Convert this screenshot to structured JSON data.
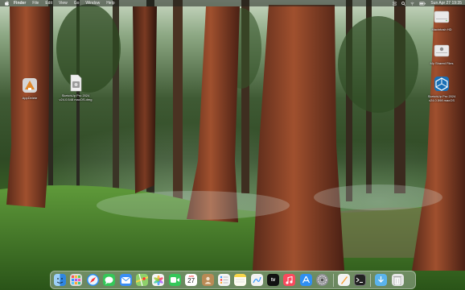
{
  "menubar": {
    "app_name": "Finder",
    "items": [
      "File",
      "Edit",
      "View",
      "Go",
      "Window",
      "Help"
    ],
    "clock": "Sun Apr 27 19:35",
    "status_icons": [
      "control-center-icon",
      "spotlight-icon",
      "wifi-icon",
      "battery-icon"
    ]
  },
  "desktop": {
    "icons": [
      {
        "label": "AppDelete",
        "icon": "app-delete-icon"
      },
      {
        "label": "SketchUp Pro 2024",
        "label2": "v24.0.548 macOS.dmg",
        "icon": "disk-image-icon"
      },
      {
        "label": "Macintosh HD",
        "icon": "hard-drive-icon"
      },
      {
        "label": "My Shared Files",
        "icon": "shared-drive-icon"
      },
      {
        "label": "SketchUp Pro 2024",
        "label2": "v24.0.598 macOS",
        "icon": "sketchup-icon"
      }
    ]
  },
  "dock": {
    "apps": [
      {
        "name": "Finder",
        "icon": "finder-icon",
        "color": "#4aa3f0"
      },
      {
        "name": "Launchpad",
        "icon": "launchpad-icon",
        "color": "#d9d9d9"
      },
      {
        "name": "Safari",
        "icon": "safari-icon",
        "color": "#2f8ff2"
      },
      {
        "name": "Messages",
        "icon": "messages-icon",
        "color": "#35c759"
      },
      {
        "name": "Mail",
        "icon": "mail-icon",
        "color": "#3a8ef5"
      },
      {
        "name": "Maps",
        "icon": "maps-icon",
        "color": "#6cc46a"
      },
      {
        "name": "Photos",
        "icon": "photos-icon",
        "color": "#f5f5f5"
      },
      {
        "name": "FaceTime",
        "icon": "facetime-icon",
        "color": "#34c759"
      },
      {
        "name": "Calendar",
        "icon": "calendar-icon",
        "color": "#ffffff",
        "text": "27",
        "subtext": "APR"
      },
      {
        "name": "Contacts",
        "icon": "contacts-icon",
        "color": "#b98a55"
      },
      {
        "name": "Reminders",
        "icon": "reminders-icon",
        "color": "#f4f4f4"
      },
      {
        "name": "Notes",
        "icon": "notes-icon",
        "color": "#f7d64a"
      },
      {
        "name": "Freeform",
        "icon": "freeform-icon",
        "color": "#f2f2f2"
      },
      {
        "name": "Apple TV",
        "icon": "tv-icon",
        "color": "#111111",
        "text": "tv"
      },
      {
        "name": "Music",
        "icon": "music-icon",
        "color": "#fa4a5e"
      },
      {
        "name": "App Store",
        "icon": "app-store-icon",
        "color": "#2f8ff2"
      },
      {
        "name": "System Settings",
        "icon": "settings-icon",
        "color": "#8e8e93"
      },
      {
        "name": "Pages",
        "icon": "pages-icon",
        "color": "#f3f3f3"
      },
      {
        "name": "Terminal",
        "icon": "terminal-icon",
        "color": "#222222"
      },
      {
        "name": "Downloads",
        "icon": "downloads-folder-icon",
        "color": "#5ab3ec"
      },
      {
        "name": "Trash",
        "icon": "trash-icon",
        "color": "#e6e6e6"
      }
    ]
  }
}
